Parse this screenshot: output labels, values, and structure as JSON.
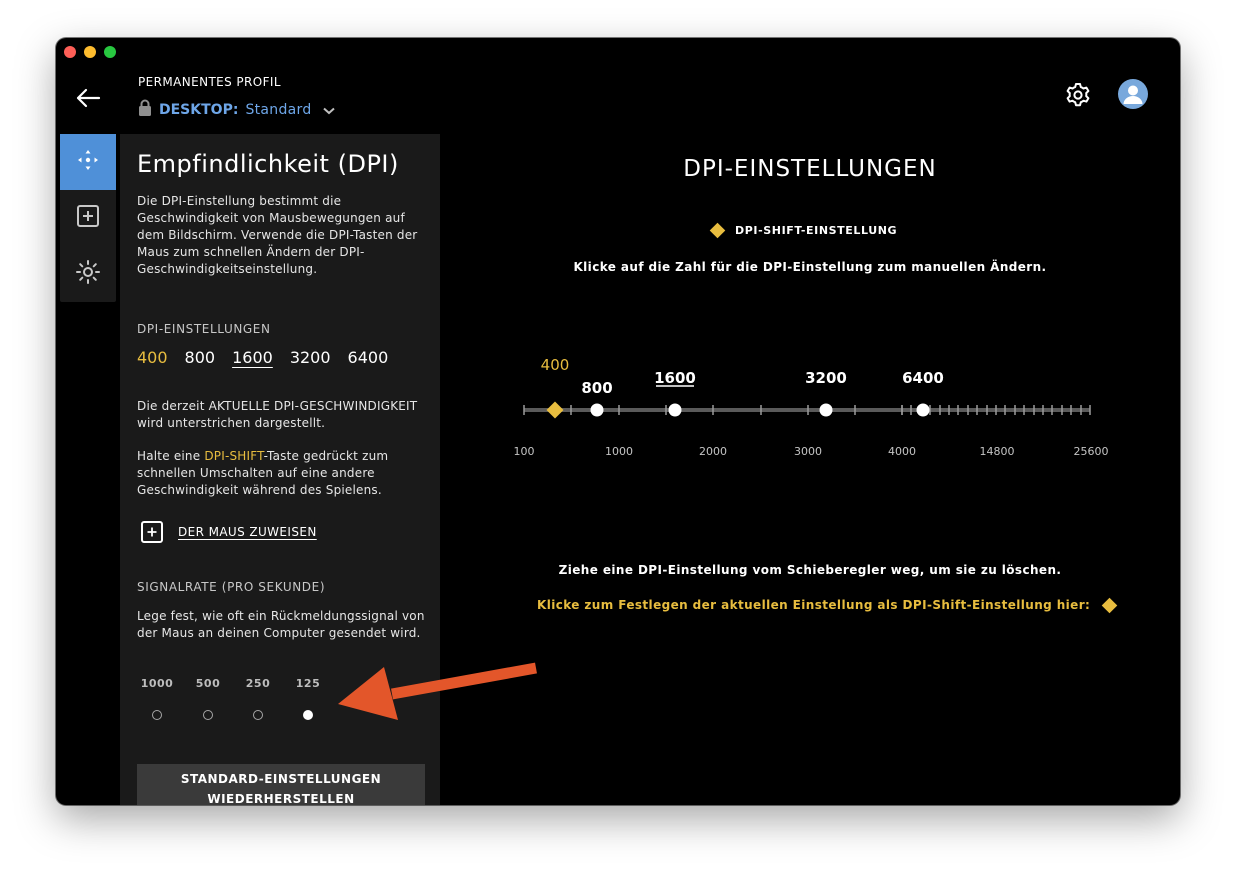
{
  "profile": {
    "label": "PERMANENTES PROFIL",
    "kind": "DESKTOP:",
    "name": "Standard"
  },
  "icons": [
    "back-arrow-icon",
    "lock-icon",
    "chevron-down-icon",
    "gear-icon",
    "user-avatar-icon",
    "move-arrows-icon",
    "plus-square-icon",
    "lighting-icon"
  ],
  "panel": {
    "title": "Empfindlichkeit (DPI)",
    "intro": "Die DPI-Einstellung bestimmt die Geschwindigkeit von Mausbewegungen auf dem Bildschirm. Verwende die DPI-Tasten der Maus zum schnellen Ändern der DPI-Geschwindigkeitseinstellung.",
    "dpi_heading": "DPI-EINSTELLUNGEN",
    "dpi_values": [
      "400",
      "800",
      "1600",
      "3200",
      "6400"
    ],
    "current_note": "Die derzeit AKTUELLE DPI-GESCHWINDIGKEIT wird unterstrichen dargestellt.",
    "shift_note_pre": "Halte eine ",
    "shift_note_hl": "DPI-SHIFT",
    "shift_note_post": "-Taste gedrückt zum schnellen Umschalten auf eine andere Geschwindigkeit während des Spielens.",
    "assign_label": "DER MAUS ZUWEISEN",
    "rate_heading": "SIGNALRATE (PRO SEKUNDE)",
    "rate_text": "Lege fest, wie oft ein Rückmeldungssignal von der Maus an deinen Computer gesendet wird.",
    "rates": [
      "1000",
      "500",
      "250",
      "125"
    ],
    "selected_rate": "125",
    "reset_line1": "STANDARD-EINSTELLUNGEN",
    "reset_line2": "WIEDERHERSTELLEN"
  },
  "main": {
    "title": "DPI-EINSTELLUNGEN",
    "shift_legend": "DPI-SHIFT-EINSTELLUNG",
    "hint_click": "Klicke auf die Zahl für die DPI-Einstellung zum manuellen Ändern.",
    "hint_drag": "Ziehe eine DPI-Einstellung vom Schieberegler weg, um sie zu löschen.",
    "hint_shift": "Klicke zum Festlegen der aktuellen Einstellung als DPI-Shift-Einstellung hier:"
  },
  "slider": {
    "scale_labels": [
      "100",
      "1000",
      "2000",
      "3000",
      "4000",
      "14800",
      "25600"
    ],
    "markers": [
      {
        "label": "400",
        "type": "shift",
        "value": 400
      },
      {
        "label": "800",
        "type": "normal",
        "value": 800
      },
      {
        "label": "1600",
        "type": "current",
        "value": 1600
      },
      {
        "label": "3200",
        "type": "normal",
        "value": 3200
      },
      {
        "label": "6400",
        "type": "normal",
        "value": 6400
      }
    ]
  },
  "colors": {
    "accent_blue": "#4f90d8",
    "shift_yellow": "#e8bd3f",
    "background": "#000000",
    "panel": "#1a1a1a"
  }
}
